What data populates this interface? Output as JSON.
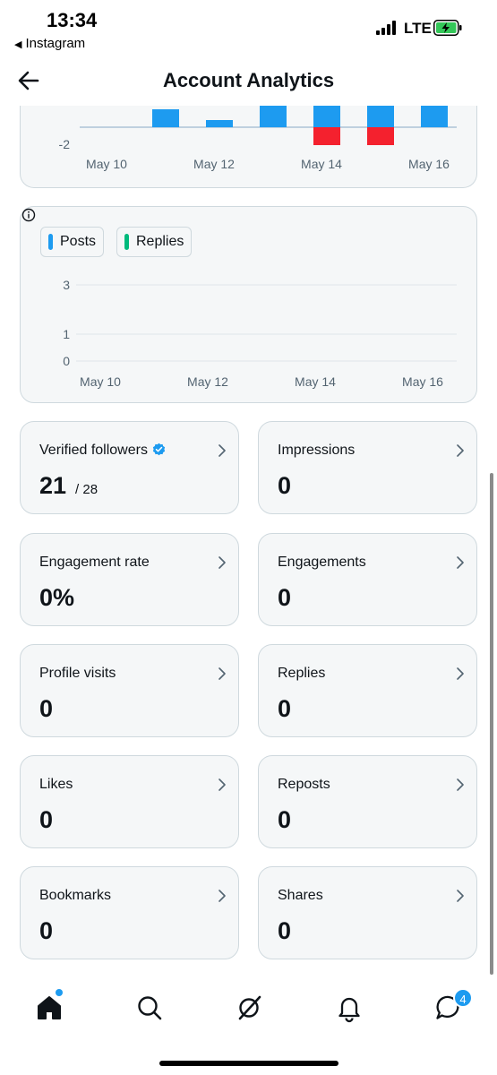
{
  "status_bar": {
    "time": "13:34",
    "back_app": "Instagram",
    "network": "LTE"
  },
  "header": {
    "title": "Account Analytics"
  },
  "chart_data": [
    {
      "type": "bar",
      "x": [
        "May 10",
        "May 11",
        "May 12",
        "May 13",
        "May 14",
        "May 15",
        "May 16"
      ],
      "xtick_labels": [
        "May 10",
        "May 12",
        "May 14",
        "May 16"
      ],
      "ytick_labels": [
        "-2"
      ],
      "series": [
        {
          "color": "#1d9bf0",
          "values": [
            0,
            1,
            0.4,
            1.5,
            1.5,
            1.5,
            1.5
          ]
        },
        {
          "color": "#f4212e",
          "values": [
            0,
            0,
            0,
            0,
            -1,
            -1,
            0
          ]
        }
      ]
    },
    {
      "type": "line",
      "x": [
        "May 10",
        "May 11",
        "May 12",
        "May 13",
        "May 14",
        "May 15",
        "May 16"
      ],
      "xtick_labels": [
        "May 10",
        "May 12",
        "May 14",
        "May 16"
      ],
      "ytick_labels": [
        "3",
        "1",
        "0"
      ],
      "series": [
        {
          "name": "Posts",
          "color": "#1d9bf0",
          "values": [
            0,
            0,
            0,
            0,
            0,
            0,
            0
          ]
        },
        {
          "name": "Replies",
          "color": "#00ba7c",
          "values": [
            0,
            0,
            0,
            0,
            0,
            0,
            0
          ]
        }
      ]
    }
  ],
  "metrics": [
    {
      "label": "Verified followers",
      "value": "21",
      "sub": "/ 28"
    },
    {
      "label": "Impressions",
      "value": "0"
    },
    {
      "label": "Engagement rate",
      "value": "0%"
    },
    {
      "label": "Engagements",
      "value": "0"
    },
    {
      "label": "Profile visits",
      "value": "0"
    },
    {
      "label": "Replies",
      "value": "0"
    },
    {
      "label": "Likes",
      "value": "0"
    },
    {
      "label": "Reposts",
      "value": "0"
    },
    {
      "label": "Bookmarks",
      "value": "0"
    },
    {
      "label": "Shares",
      "value": "0"
    }
  ],
  "bottom_nav": {
    "messages_badge": "4"
  },
  "colors": {
    "accent": "#1d9bf0",
    "negative": "#f4212e",
    "replies": "#00ba7c",
    "card_bg": "#f5f7f8",
    "border": "#cfd9de"
  }
}
